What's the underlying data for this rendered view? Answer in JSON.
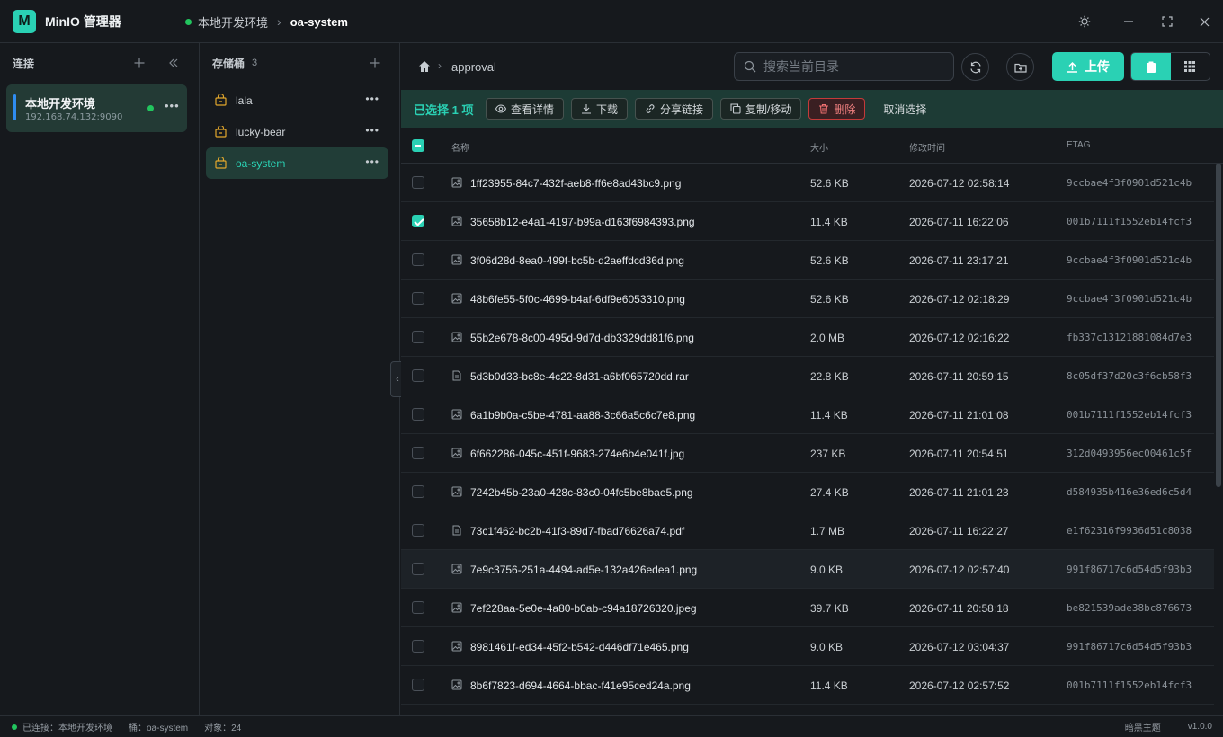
{
  "app": {
    "logo_letter": "M",
    "title": "MinIO 管理器"
  },
  "breadcrumb": {
    "connection": "本地开发环境",
    "bucket": "oa-system"
  },
  "connections": {
    "header": "连接",
    "items": [
      {
        "name": "本地开发环境",
        "host": "192.168.74.132:9090",
        "status_color": "#22c55e"
      }
    ]
  },
  "buckets": {
    "header": "存储桶",
    "count": "3",
    "items": [
      {
        "name": "lala"
      },
      {
        "name": "lucky-bear"
      },
      {
        "name": "oa-system",
        "active": true
      }
    ]
  },
  "toolbar": {
    "path": "approval",
    "search_placeholder": "搜索当前目录",
    "upload_label": "上传"
  },
  "selection": {
    "count_label": "已选择 1 项",
    "actions": {
      "details": "查看详情",
      "download": "下载",
      "share": "分享链接",
      "copy_move": "复制/移动",
      "delete": "删除"
    },
    "cancel": "取消选择"
  },
  "table": {
    "columns": {
      "name": "名称",
      "size": "大小",
      "modified": "修改时间",
      "etag": "ETAG"
    },
    "rows": [
      {
        "name": "1ff23955-84c7-432f-aeb8-ff6e8ad43bc9.png",
        "size": "52.6 KB",
        "modified": "2026-07-12 02:58:14",
        "etag": "9ccbae4f3f0901d521c4b",
        "type": "image",
        "checked": false
      },
      {
        "name": "35658b12-e4a1-4197-b99a-d163f6984393.png",
        "size": "11.4 KB",
        "modified": "2026-07-11 16:22:06",
        "etag": "001b7111f1552eb14fcf3",
        "type": "image",
        "checked": true
      },
      {
        "name": "3f06d28d-8ea0-499f-bc5b-d2aeffdcd36d.png",
        "size": "52.6 KB",
        "modified": "2026-07-11 23:17:21",
        "etag": "9ccbae4f3f0901d521c4b",
        "type": "image",
        "checked": false
      },
      {
        "name": "48b6fe55-5f0c-4699-b4af-6df9e6053310.png",
        "size": "52.6 KB",
        "modified": "2026-07-12 02:18:29",
        "etag": "9ccbae4f3f0901d521c4b",
        "type": "image",
        "checked": false
      },
      {
        "name": "55b2e678-8c00-495d-9d7d-db3329dd81f6.png",
        "size": "2.0 MB",
        "modified": "2026-07-12 02:16:22",
        "etag": "fb337c13121881084d7e3",
        "type": "image",
        "checked": false
      },
      {
        "name": "5d3b0d33-bc8e-4c22-8d31-a6bf065720dd.rar",
        "size": "22.8 KB",
        "modified": "2026-07-11 20:59:15",
        "etag": "8c05df37d20c3f6cb58f3",
        "type": "file",
        "checked": false
      },
      {
        "name": "6a1b9b0a-c5be-4781-aa88-3c66a5c6c7e8.png",
        "size": "11.4 KB",
        "modified": "2026-07-11 21:01:08",
        "etag": "001b7111f1552eb14fcf3",
        "type": "image",
        "checked": false
      },
      {
        "name": "6f662286-045c-451f-9683-274e6b4e041f.jpg",
        "size": "237 KB",
        "modified": "2026-07-11 20:54:51",
        "etag": "312d0493956ec00461c5f",
        "type": "image",
        "checked": false
      },
      {
        "name": "7242b45b-23a0-428c-83c0-04fc5be8bae5.png",
        "size": "27.4 KB",
        "modified": "2026-07-11 21:01:23",
        "etag": "d584935b416e36ed6c5d4",
        "type": "image",
        "checked": false
      },
      {
        "name": "73c1f462-bc2b-41f3-89d7-fbad76626a74.pdf",
        "size": "1.7 MB",
        "modified": "2026-07-11 16:22:27",
        "etag": "e1f62316f9936d51c8038",
        "type": "file",
        "checked": false
      },
      {
        "name": "7e9c3756-251a-4494-ad5e-132a426edea1.png",
        "size": "9.0 KB",
        "modified": "2026-07-12 02:57:40",
        "etag": "991f86717c6d54d5f93b3",
        "type": "image",
        "checked": false,
        "hover": true
      },
      {
        "name": "7ef228aa-5e0e-4a80-b0ab-c94a18726320.jpeg",
        "size": "39.7 KB",
        "modified": "2026-07-11 20:58:18",
        "etag": "be821539ade38bc876673",
        "type": "image",
        "checked": false
      },
      {
        "name": "8981461f-ed34-45f2-b542-d446df71e465.png",
        "size": "9.0 KB",
        "modified": "2026-07-12 03:04:37",
        "etag": "991f86717c6d54d5f93b3",
        "type": "image",
        "checked": false
      },
      {
        "name": "8b6f7823-d694-4664-bbac-f41e95ced24a.png",
        "size": "11.4 KB",
        "modified": "2026-07-12 02:57:52",
        "etag": "001b7111f1552eb14fcf3",
        "type": "image",
        "checked": false
      }
    ]
  },
  "status_bar": {
    "connected": "已连接：本地开发环境",
    "bucket": "桶：oa-system",
    "objects": "对象：24",
    "theme": "暗黑主题",
    "version": "v1.0.0"
  },
  "colors": {
    "accent": "#2ad1b4",
    "danger": "#c43a3a",
    "online": "#22c55e",
    "bucket_icon": "#e2a72c"
  }
}
